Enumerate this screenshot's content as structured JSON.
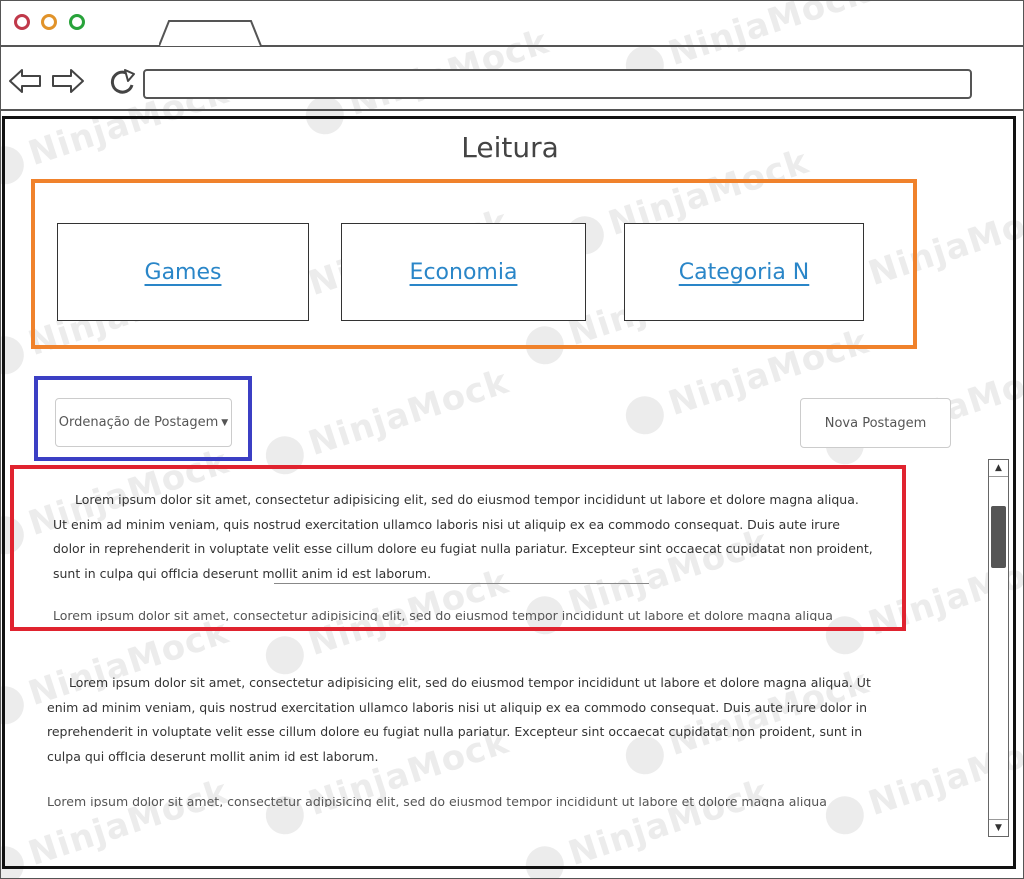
{
  "browser": {
    "window_controls": [
      "close",
      "minimize",
      "maximize"
    ],
    "nav_icons": {
      "back": "arrow-left-icon",
      "forward": "arrow-right-icon",
      "reload": "reload-icon"
    },
    "url": ""
  },
  "page": {
    "title": "Leitura",
    "categories": [
      {
        "label": "Games"
      },
      {
        "label": "Economia"
      },
      {
        "label": "Categoria N"
      }
    ],
    "sort": {
      "label": "Ordenação de Postagem"
    },
    "new_post": {
      "label": "Nova Postagem"
    },
    "posts": [
      {
        "text": "Lorem ipsum dolor sit amet, consectetur adipisicing elit, sed do eiusmod tempor incididunt ut labore et dolore magna aliqua. Ut enim ad minim veniam, quis nostrud exercitation ullamco laboris nisi ut aliquip ex ea commodo consequat. Duis aute irure dolor in reprehenderit in voluptate velit esse cillum dolore eu fugiat nulla pariatur. Excepteur sint occaecat cupidatat non proident, sunt in culpa qui offIcia deserunt mollit anim id est laborum."
      },
      {
        "text": "Lorem ipsum dolor sit amet, consectetur adipisicing elit, sed do eiusmod tempor incididunt ut labore et dolore magna aliqua. Ut enim ad minim veniam, quis nostrud exercitation ullamco laboris nisi ut aliquip ex ea commodo consequat. Duis aute irure dolor in reprehenderit in voluptate velit esse cillum dolore eu fugiat nulla pariatur. Excepteur sint occaecat cupidatat non proident, sunt in culpa qui offIcia deserunt mollit anim id est laborum."
      }
    ]
  },
  "watermark": {
    "text": "NinjaMock"
  },
  "colors": {
    "category_group_border": "#f0822c",
    "sort_group_border": "#3b3fc4",
    "post_highlight_border": "#e0232f",
    "link": "#2a86c8"
  }
}
